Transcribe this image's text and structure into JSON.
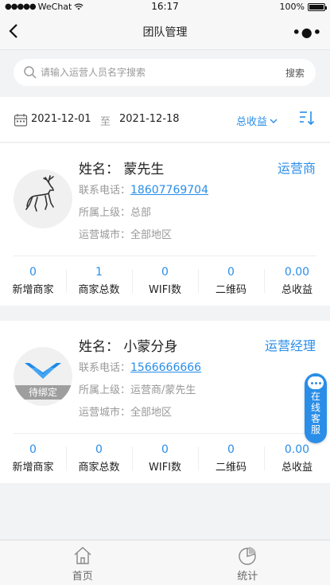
{
  "status_bar": {
    "carrier": "WeChat",
    "time": "16:17",
    "battery": "100%"
  },
  "nav": {
    "title": "团队管理"
  },
  "search": {
    "placeholder": "请输入运营人员名字搜索",
    "button": "搜索"
  },
  "filter": {
    "start_date": "2021-12-01",
    "to": "至",
    "end_date": "2021-12-18",
    "sort_label": "总收益"
  },
  "labels": {
    "phone": "联系电话：",
    "superior": "所属上级：",
    "city": "运营城市："
  },
  "members": [
    {
      "name": "姓名：  蒙先生",
      "role": "运营商",
      "phone": "18607769704",
      "superior": "总部",
      "city": "全部地区",
      "stats": [
        {
          "value": "0",
          "label": "新增商家"
        },
        {
          "value": "1",
          "label": "商家总数"
        },
        {
          "value": "0",
          "label": "WIFI数"
        },
        {
          "value": "0",
          "label": "二维码"
        },
        {
          "value": "0.00",
          "label": "总收益"
        }
      ]
    },
    {
      "name": "姓名：  小蒙分身",
      "role": "运营经理",
      "badge": "待绑定",
      "phone": "1566666666",
      "superior": "运营商/蒙先生",
      "city": "全部地区",
      "stats": [
        {
          "value": "0",
          "label": "新增商家"
        },
        {
          "value": "0",
          "label": "商家总数"
        },
        {
          "value": "0",
          "label": "WIFI数"
        },
        {
          "value": "0",
          "label": "二维码"
        },
        {
          "value": "0.00",
          "label": "总收益"
        }
      ]
    }
  ],
  "service": {
    "label_chars": [
      "在",
      "线",
      "客",
      "服"
    ]
  },
  "tabs": [
    {
      "label": "首页",
      "icon": "home-icon"
    },
    {
      "label": "统计",
      "icon": "pie-chart-icon"
    }
  ],
  "colors": {
    "accent": "#2a8ee8"
  }
}
